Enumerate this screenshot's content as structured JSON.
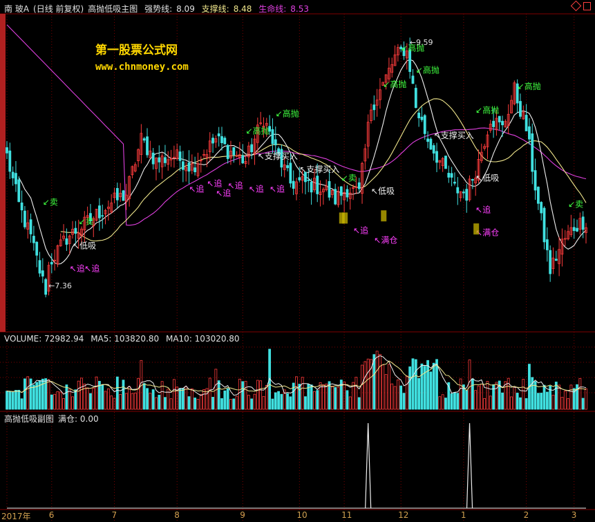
{
  "header": {
    "stock": "南 玻A",
    "mode": "(日线 前复权)",
    "indicator": "高抛低吸主图",
    "strong_label": "强势线:",
    "strong_value": "8.09",
    "support_label": "支撑线:",
    "support_value": "8.48",
    "life_label": "生命线:",
    "life_value": "8.53"
  },
  "watermark": {
    "line1": "第一股票公式网",
    "line2": "www.chnmoney.com"
  },
  "volume_header": {
    "label": "VOLUME: 72982.94",
    "ma5": "MA5: 103820.80",
    "ma10": "MA10: 103020.80"
  },
  "sub_header": {
    "label": "高抛低吸副图",
    "full_label": "满仓: 0.00"
  },
  "colors": {
    "up": "#ff3c3c",
    "down": "#40e0e0",
    "life": "#e040e0",
    "strong": "#f0f0f0",
    "support": "#f0e68c",
    "signal_green": "#40ff40",
    "signal_magenta": "#ff40ff",
    "grid": "#800000"
  },
  "chart_data": {
    "type": "candlestick",
    "x_ticks": [
      {
        "label": "2017年",
        "i": 0
      },
      {
        "label": "6",
        "i": 15
      },
      {
        "label": "7",
        "i": 36
      },
      {
        "label": "8",
        "i": 57
      },
      {
        "label": "9",
        "i": 79
      },
      {
        "label": "10",
        "i": 98
      },
      {
        "label": "11",
        "i": 113
      },
      {
        "label": "12",
        "i": 132
      },
      {
        "label": "1",
        "i": 153
      },
      {
        "label": "2",
        "i": 174
      },
      {
        "label": "3",
        "i": 190
      }
    ],
    "ylim": [
      7.0,
      9.85
    ],
    "price_annotations": [
      {
        "text": "9.59",
        "i": 134,
        "value": 9.59
      },
      {
        "text": "7.36",
        "i": 13,
        "value": 7.36
      }
    ],
    "key_points": [
      [
        0,
        8.55
      ],
      [
        4,
        8.1
      ],
      [
        8,
        7.8
      ],
      [
        12,
        7.4
      ],
      [
        15,
        7.6
      ],
      [
        20,
        7.8
      ],
      [
        26,
        7.92
      ],
      [
        34,
        8.1
      ],
      [
        40,
        8.2
      ],
      [
        45,
        8.7
      ],
      [
        50,
        8.5
      ],
      [
        56,
        8.55
      ],
      [
        62,
        8.45
      ],
      [
        70,
        8.7
      ],
      [
        74,
        8.6
      ],
      [
        80,
        8.5
      ],
      [
        86,
        8.9
      ],
      [
        90,
        8.6
      ],
      [
        95,
        8.3
      ],
      [
        100,
        8.3
      ],
      [
        106,
        8.25
      ],
      [
        110,
        8.15
      ],
      [
        114,
        8.25
      ],
      [
        118,
        8.2
      ],
      [
        122,
        9.0
      ],
      [
        126,
        9.2
      ],
      [
        130,
        9.45
      ],
      [
        134,
        9.55
      ],
      [
        137,
        9.0
      ],
      [
        141,
        8.7
      ],
      [
        146,
        8.45
      ],
      [
        150,
        8.25
      ],
      [
        154,
        8.2
      ],
      [
        158,
        8.5
      ],
      [
        162,
        8.9
      ],
      [
        166,
        8.8
      ],
      [
        170,
        9.15
      ],
      [
        174,
        8.8
      ],
      [
        178,
        8.1
      ],
      [
        182,
        7.5
      ],
      [
        186,
        7.75
      ],
      [
        190,
        7.9
      ],
      [
        193,
        7.95
      ]
    ],
    "series": [
      {
        "name": "强势线",
        "value_last": 8.09
      },
      {
        "name": "支撑线",
        "value_last": 8.48
      },
      {
        "name": "生命线",
        "value_last": 8.53
      }
    ],
    "volume_ma5_last": 103820.8,
    "volume_ma10_last": 103020.8,
    "volume_last": 72982.94,
    "full_spikes_i": [
      121,
      155
    ],
    "signals": [
      {
        "text": "卖",
        "i": 12,
        "value": 8.1,
        "kind": "green"
      },
      {
        "text": "卖",
        "i": 24,
        "value": 7.92,
        "kind": "green"
      },
      {
        "text": "低吸",
        "i": 22,
        "value": 7.7,
        "kind": "white"
      },
      {
        "text": "追",
        "i": 21,
        "value": 7.49,
        "kind": "magenta"
      },
      {
        "text": "追",
        "i": 26,
        "value": 7.49,
        "kind": "magenta"
      },
      {
        "text": "追",
        "i": 61,
        "value": 8.22,
        "kind": "magenta"
      },
      {
        "text": "追",
        "i": 67,
        "value": 8.27,
        "kind": "magenta"
      },
      {
        "text": "追",
        "i": 70,
        "value": 8.18,
        "kind": "magenta"
      },
      {
        "text": "追",
        "i": 74,
        "value": 8.25,
        "kind": "magenta"
      },
      {
        "text": "追",
        "i": 81,
        "value": 8.22,
        "kind": "magenta"
      },
      {
        "text": "追",
        "i": 88,
        "value": 8.22,
        "kind": "magenta"
      },
      {
        "text": "高抛",
        "i": 80,
        "value": 8.75,
        "kind": "green"
      },
      {
        "text": "高抛",
        "i": 90,
        "value": 8.91,
        "kind": "green"
      },
      {
        "text": "支撑买入",
        "i": 84,
        "value": 8.52,
        "kind": "white"
      },
      {
        "text": "支撑买入",
        "i": 98,
        "value": 8.4,
        "kind": "white"
      },
      {
        "text": "卖",
        "i": 112,
        "value": 8.32,
        "kind": "green"
      },
      {
        "text": "低吸",
        "i": 122,
        "value": 8.2,
        "kind": "white"
      },
      {
        "text": "追",
        "i": 116,
        "value": 7.84,
        "kind": "magenta"
      },
      {
        "text": "满仓",
        "i": 123,
        "value": 7.75,
        "kind": "magenta"
      },
      {
        "text": "高抛",
        "i": 126,
        "value": 9.18,
        "kind": "green"
      },
      {
        "text": "高抛",
        "i": 132,
        "value": 9.51,
        "kind": "green"
      },
      {
        "text": "高抛",
        "i": 137,
        "value": 9.31,
        "kind": "green"
      },
      {
        "text": "支撑买入",
        "i": 143,
        "value": 8.71,
        "kind": "white"
      },
      {
        "text": "高抛",
        "i": 157,
        "value": 8.94,
        "kind": "green"
      },
      {
        "text": "高抛",
        "i": 171,
        "value": 9.16,
        "kind": "green"
      },
      {
        "text": "低吸",
        "i": 157,
        "value": 8.32,
        "kind": "white"
      },
      {
        "text": "追",
        "i": 157,
        "value": 8.03,
        "kind": "magenta"
      },
      {
        "text": "满仓",
        "i": 157,
        "value": 7.82,
        "kind": "magenta"
      },
      {
        "text": "卖",
        "i": 188,
        "value": 8.08,
        "kind": "green"
      }
    ]
  }
}
